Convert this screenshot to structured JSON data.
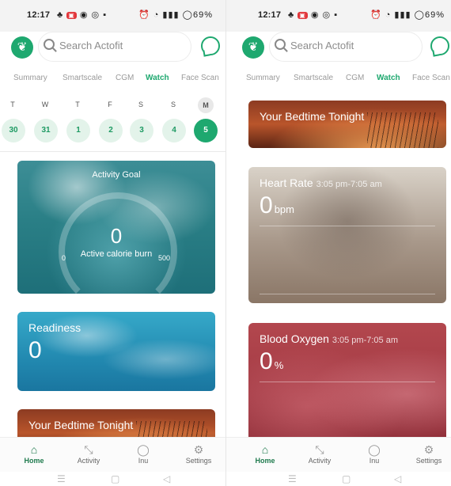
{
  "status_bar": {
    "time": "12:17",
    "battery": "69%"
  },
  "search": {
    "placeholder": "Search Actofit"
  },
  "tabs": [
    "Summary",
    "Smartscale",
    "CGM",
    "Watch",
    "Face Scan"
  ],
  "active_tab": "Watch",
  "week": {
    "days": [
      "T",
      "W",
      "T",
      "F",
      "S",
      "S",
      "M"
    ],
    "dates": [
      "30",
      "31",
      "1",
      "2",
      "3",
      "4",
      "5"
    ],
    "selected_index": 6
  },
  "activity_goal": {
    "title": "Activity Goal",
    "value": "0",
    "subtitle": "Active calorie burn",
    "min": "0",
    "max": "500"
  },
  "readiness": {
    "title": "Readiness",
    "value": "0"
  },
  "bedtime": {
    "title": "Your Bedtime Tonight"
  },
  "heart_rate": {
    "title": "Heart Rate",
    "time_range": "3:05 pm-7:05 am",
    "value": "0",
    "unit": "bpm"
  },
  "blood_oxygen": {
    "title": "Blood Oxygen",
    "time_range": "3:05 pm-7:05 am",
    "value": "0",
    "unit": "%"
  },
  "bottom_nav": [
    {
      "label": "Home",
      "icon": "home-icon",
      "active": true
    },
    {
      "label": "Activity",
      "icon": "activity-icon",
      "active": false
    },
    {
      "label": "Inu",
      "icon": "chat-icon",
      "active": false
    },
    {
      "label": "Settings",
      "icon": "gear-icon",
      "active": false
    }
  ],
  "colors": {
    "accent": "#1ea86f"
  }
}
